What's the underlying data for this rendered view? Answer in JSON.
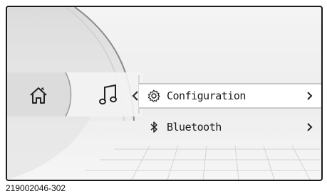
{
  "menu": {
    "items": [
      {
        "label": "Configuration",
        "icon": "gear-icon",
        "selected": true
      },
      {
        "label": "Bluetooth",
        "icon": "bluetooth-icon",
        "selected": false
      }
    ]
  },
  "nav": {
    "icons": [
      "home-icon",
      "music-note-icon",
      "chevron-left-icon"
    ]
  },
  "caption": "219002046-302"
}
